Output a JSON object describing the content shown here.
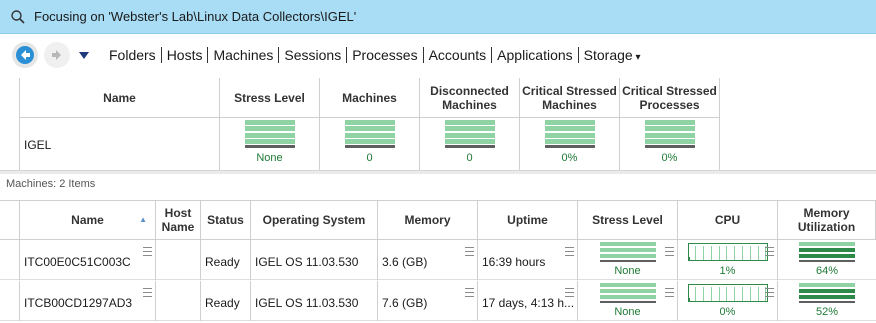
{
  "focus": {
    "text": "Focusing on 'Webster's Lab\\Linux Data Collectors\\IGEL'"
  },
  "nav": {
    "links": [
      "Folders",
      "Hosts",
      "Machines",
      "Sessions",
      "Processes",
      "Accounts",
      "Applications",
      "Storage"
    ]
  },
  "summary": {
    "headers": [
      "Name",
      "Stress Level",
      "Machines",
      "Disconnected Machines",
      "Critical Stressed Machines",
      "Critical Stressed Processes"
    ],
    "row": {
      "name": "IGEL",
      "stress": "None",
      "machines": "0",
      "disconnected": "0",
      "critical_machines": "0%",
      "critical_processes": "0%"
    }
  },
  "machines_count": "Machines: 2 Items",
  "machines": {
    "headers": [
      "Name",
      "Host Name",
      "Status",
      "Operating System",
      "Memory",
      "Uptime",
      "Stress Level",
      "CPU",
      "Memory Utilization"
    ],
    "rows": [
      {
        "name": "ITC00E0C51C003C",
        "host": "",
        "status": "Ready",
        "os": "IGEL OS 11.03.530",
        "memory": "3.6 (GB)",
        "uptime": "16:39 hours",
        "stress": "None",
        "cpu": "1%",
        "mem_util": "64%",
        "cpu_level": 0.01,
        "mem_level": 0.64
      },
      {
        "name": "ITCB00CD1297AD3",
        "host": "",
        "status": "Ready",
        "os": "IGEL OS 11.03.530",
        "memory": "7.6 (GB)",
        "uptime": "17 days, 4:13 h...",
        "stress": "None",
        "cpu": "0%",
        "mem_util": "52%",
        "cpu_level": 0.0,
        "mem_level": 0.52
      }
    ]
  },
  "colors": {
    "focus_bar": "#a8ddf5",
    "ok_green": "#1e7a36",
    "grid_green": "#8fd3a4",
    "accent_blue": "#2b8fd6"
  }
}
